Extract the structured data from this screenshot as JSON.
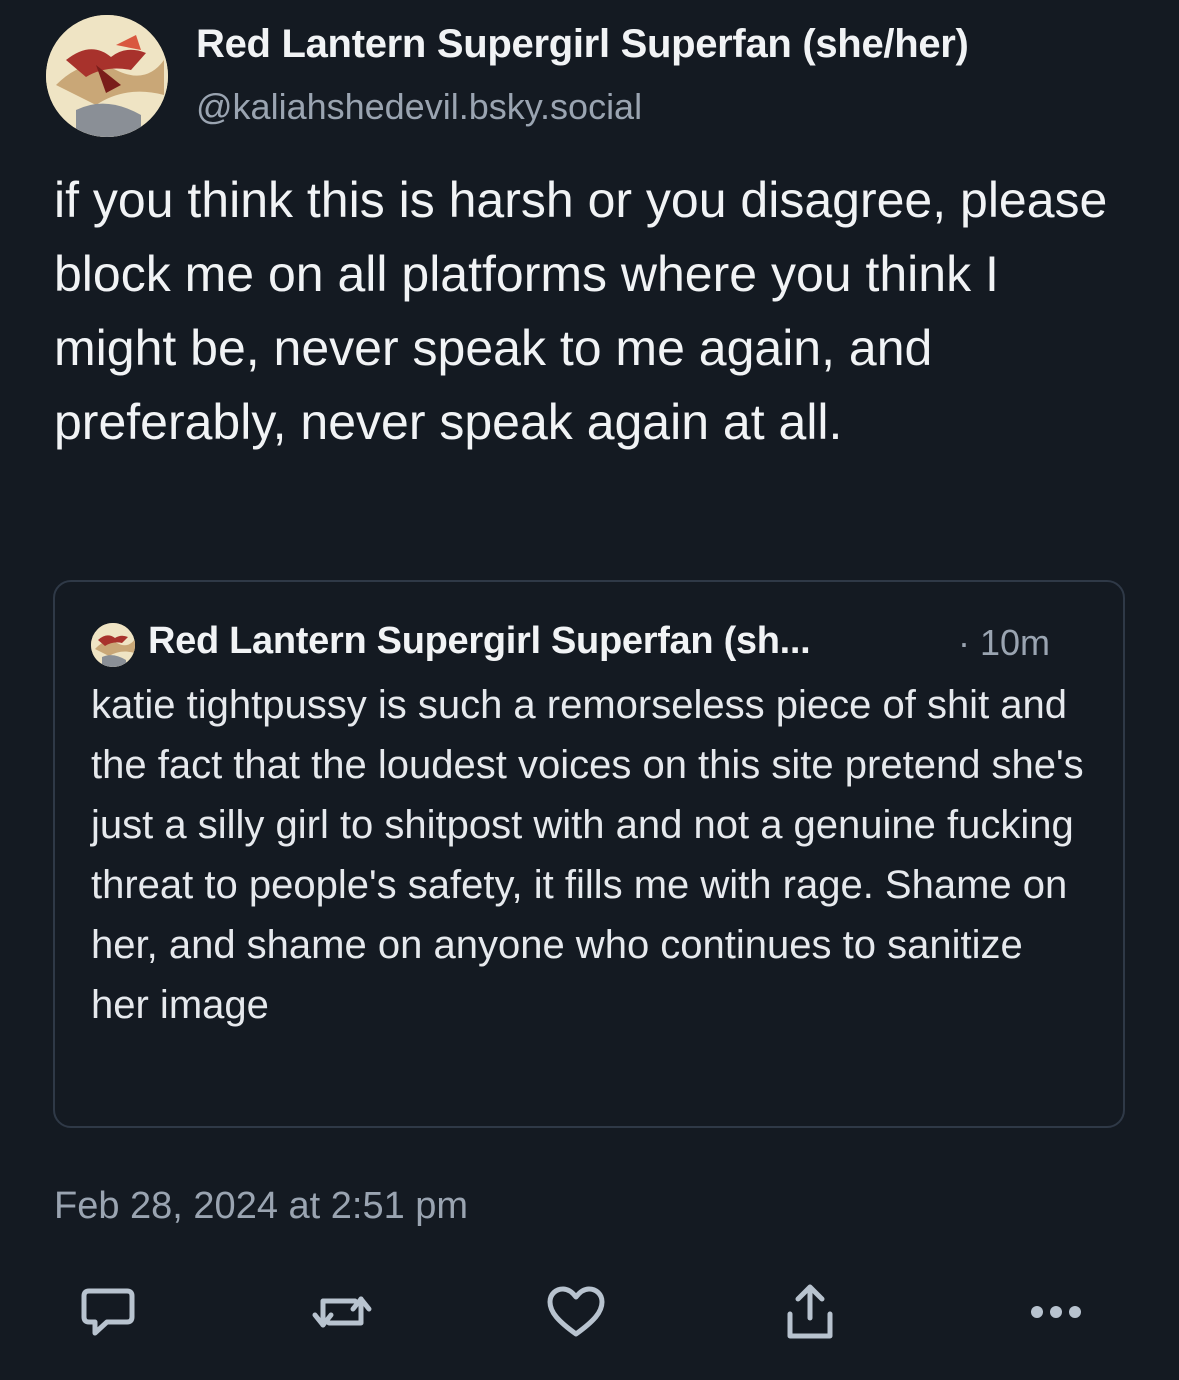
{
  "post": {
    "author": {
      "display_name": "Red Lantern Supergirl Superfan (she/her)",
      "handle": "@kaliahshedevil.bsky.social",
      "avatar_icon": "comic-art-avatar"
    },
    "text": "if you think this is harsh or you disagree, please block me on all platforms where you think I might be, never speak to me again, and preferably, never speak again at all.",
    "quote": {
      "author": "Red Lantern Supergirl Superfan (sh...",
      "time": "· 10m",
      "text": "katie tightpussy is such a remorseless piece of shit and the fact that the loudest voices on this site pretend she's just a silly girl to shitpost with and not a genuine fucking threat to people's safety, it fills me with rage. Shame on her, and shame on anyone who continues to sanitize her image"
    },
    "timestamp": "Feb 28, 2024 at 2:51 pm",
    "actions": [
      "reply-icon",
      "repost-icon",
      "like-icon",
      "share-icon",
      "more-icon"
    ]
  },
  "colors": {
    "background": "#141a22",
    "text_primary": "#f1f3f5",
    "text_secondary": "#9aa4b1",
    "card_border": "#2f3947",
    "icon": "#b8c3cf"
  }
}
